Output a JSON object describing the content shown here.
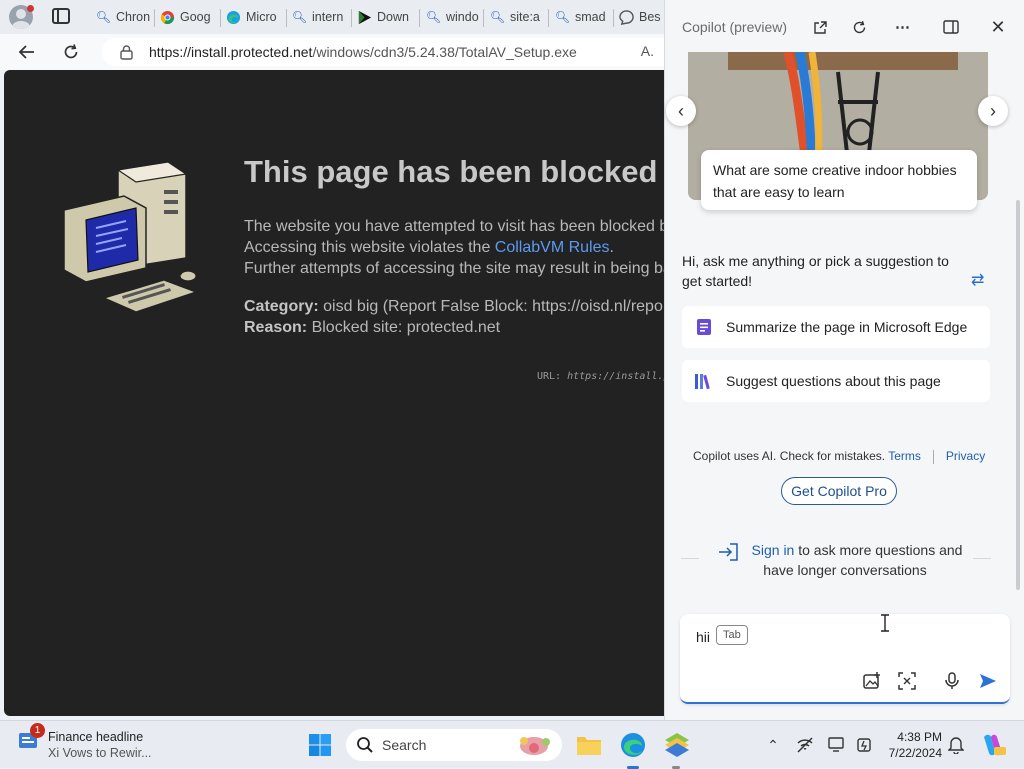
{
  "browser": {
    "tabs": [
      {
        "label": "Chron",
        "icon": "search-icon"
      },
      {
        "label": "Goog",
        "icon": "chrome-icon"
      },
      {
        "label": "Micro",
        "icon": "edge-icon"
      },
      {
        "label": "intern",
        "icon": "search-icon"
      },
      {
        "label": "Down",
        "icon": "play-icon"
      },
      {
        "label": "windo",
        "icon": "search-icon"
      },
      {
        "label": "site:a",
        "icon": "search-icon"
      },
      {
        "label": "smad",
        "icon": "search-icon"
      },
      {
        "label": "Bes",
        "icon": "chat-icon"
      }
    ],
    "address": {
      "host": "https://install.protected.net",
      "path": "/windows/cdn3/5.24.38/TotalAV_Setup.exe"
    }
  },
  "page": {
    "title": "This page has been blocked",
    "line1": "The website you have attempted to visit has been blocked b",
    "line2_prefix": "Accessing this website violates the ",
    "line2_link": "CollabVM Rules",
    "line2_suffix": ".",
    "line3": "Further attempts of accessing the site may result in being ba",
    "category_label": "Category:",
    "category_value": " oisd big (Report False Block: https://oisd.nl/repor",
    "reason_label": "Reason:",
    "reason_value": " Blocked site: protected.net",
    "url_label": "URL: ",
    "url_value": "https://install.p"
  },
  "copilot": {
    "title": "Copilot (preview)",
    "suggestion_card": "What are some creative indoor hobbies that are easy to learn",
    "greeting": "Hi, ask me anything or pick a suggestion to get started!",
    "actions": [
      {
        "label": "Summarize the page in Microsoft Edge",
        "icon": "document-icon"
      },
      {
        "label": "Suggest questions about this page",
        "icon": "books-icon"
      }
    ],
    "disclaimer": "Copilot uses AI. Check for mistakes.",
    "terms": "Terms",
    "privacy": "Privacy",
    "pro_button": "Get Copilot Pro",
    "signin_link": "Sign in",
    "signin_text": " to ask more questions and have longer conversations",
    "composer_text": "hii",
    "tab_hint": "Tab"
  },
  "taskbar": {
    "news_badge": "1",
    "news_title": "Finance headline",
    "news_sub": "Xi Vows to Rewir...",
    "search_label": "Search",
    "time": "4:38 PM",
    "date": "7/22/2024"
  },
  "colors": {
    "page_bg": "#222222",
    "link": "#5b9bf0",
    "accent": "#2b73d6"
  }
}
